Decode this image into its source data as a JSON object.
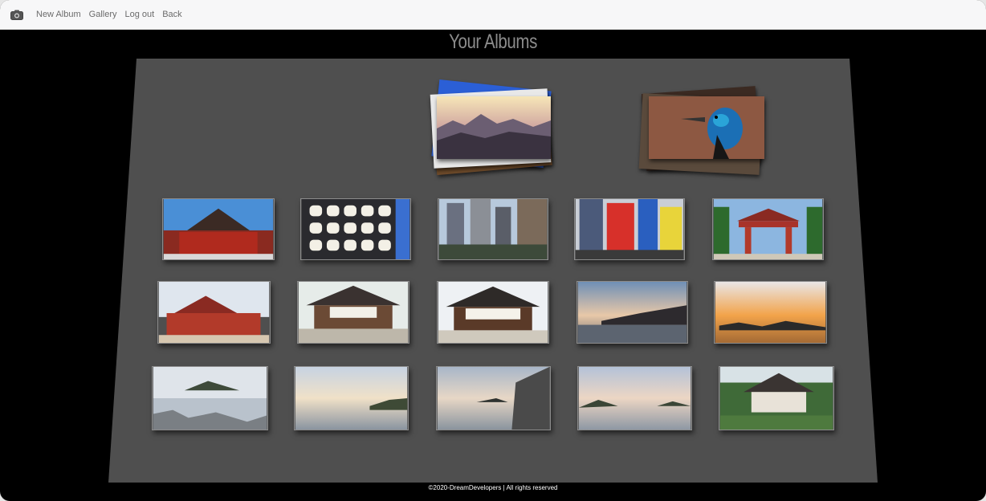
{
  "nav": {
    "brand_icon": "camera-icon",
    "links": [
      "New Album",
      "Gallery",
      "Log out",
      "Back"
    ]
  },
  "page": {
    "title": "Your Albums"
  },
  "albums": [
    {
      "cover": "mountain-sunrise-photo"
    },
    {
      "cover": "cassowary-photo"
    }
  ],
  "photos": [
    "red-temple-photo",
    "lanterns-photo",
    "city-street-photo",
    "shop-signs-photo",
    "red-gate-photo",
    "red-castle-photo",
    "shrine-hall-photo",
    "shrine-lanterns-photo",
    "sunset-lake-photo",
    "orange-sunset-photo",
    "rocky-bay-photo",
    "calm-sea-photo",
    "coastal-rock-photo",
    "cloudy-sea-photo",
    "pagoda-garden-photo"
  ],
  "footer": {
    "text": "©2020-DreamDevelopers | All rights reserved"
  },
  "colors": {
    "floor": "#4f4f4f",
    "background": "#000000",
    "navbar": "#f7f7f8"
  }
}
